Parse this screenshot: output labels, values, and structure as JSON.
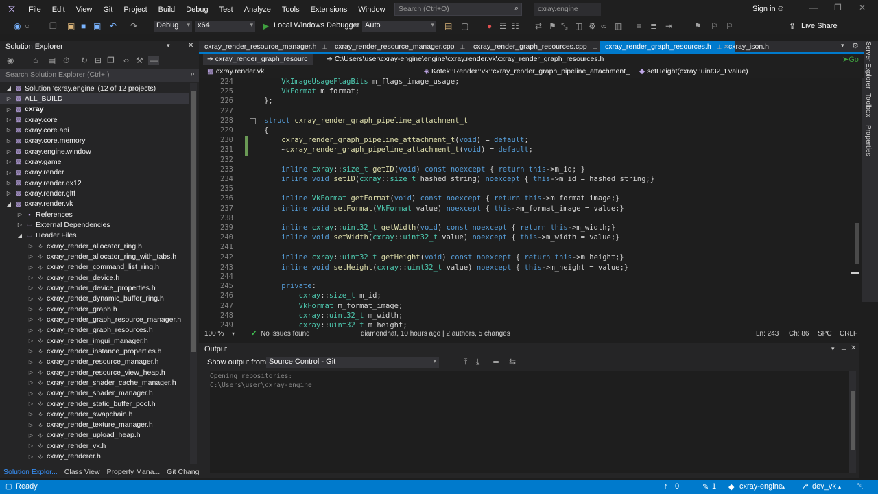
{
  "menubar": {
    "items": [
      "File",
      "Edit",
      "View",
      "Git",
      "Project",
      "Build",
      "Debug",
      "Test",
      "Analyze",
      "Tools",
      "Extensions",
      "Window",
      "Help"
    ],
    "search_placeholder": "Search (Ctrl+Q)",
    "title": "cxray.engine",
    "sign_in": "Sign in"
  },
  "toolbar": {
    "config": "Debug",
    "platform": "x64",
    "debugger": "Local Windows Debugger",
    "mode": "Auto",
    "live_share": "Live Share"
  },
  "solution_explorer": {
    "title": "Solution Explorer",
    "search_placeholder": "Search Solution Explorer (Ctrl+;)",
    "items": [
      {
        "label": "Solution 'cxray.engine' (12 of 12 projects)",
        "depth": 0,
        "twisty": "open",
        "kind": "solution"
      },
      {
        "label": "ALL_BUILD",
        "depth": 0,
        "twisty": "closed",
        "kind": "project",
        "selected": true
      },
      {
        "label": "cxray",
        "depth": 0,
        "twisty": "closed",
        "kind": "project",
        "bold": true
      },
      {
        "label": "cxray.core",
        "depth": 0,
        "twisty": "closed",
        "kind": "project"
      },
      {
        "label": "cxray.core.api",
        "depth": 0,
        "twisty": "closed",
        "kind": "project"
      },
      {
        "label": "cxray.core.memory",
        "depth": 0,
        "twisty": "closed",
        "kind": "project"
      },
      {
        "label": "cxray.engine.window",
        "depth": 0,
        "twisty": "closed",
        "kind": "project"
      },
      {
        "label": "cxray.game",
        "depth": 0,
        "twisty": "closed",
        "kind": "project"
      },
      {
        "label": "cxray.render",
        "depth": 0,
        "twisty": "closed",
        "kind": "project"
      },
      {
        "label": "cxray.render.dx12",
        "depth": 0,
        "twisty": "closed",
        "kind": "project"
      },
      {
        "label": "cxray.render.gltf",
        "depth": 0,
        "twisty": "closed",
        "kind": "project"
      },
      {
        "label": "cxray.render.vk",
        "depth": 0,
        "twisty": "open",
        "kind": "project"
      },
      {
        "label": "References",
        "depth": 1,
        "twisty": "closed",
        "kind": "ref"
      },
      {
        "label": "External Dependencies",
        "depth": 1,
        "twisty": "closed",
        "kind": "folder"
      },
      {
        "label": "Header Files",
        "depth": 1,
        "twisty": "open",
        "kind": "folder"
      },
      {
        "label": "cxray_render_allocator_ring.h",
        "depth": 2,
        "twisty": "closed",
        "kind": "file"
      },
      {
        "label": "cxray_render_allocator_ring_with_tabs.h",
        "depth": 2,
        "twisty": "closed",
        "kind": "file"
      },
      {
        "label": "cxray_render_command_list_ring.h",
        "depth": 2,
        "twisty": "closed",
        "kind": "file"
      },
      {
        "label": "cxray_render_device.h",
        "depth": 2,
        "twisty": "closed",
        "kind": "file"
      },
      {
        "label": "cxray_render_device_properties.h",
        "depth": 2,
        "twisty": "closed",
        "kind": "file"
      },
      {
        "label": "cxray_render_dynamic_buffer_ring.h",
        "depth": 2,
        "twisty": "closed",
        "kind": "file"
      },
      {
        "label": "cxray_render_graph.h",
        "depth": 2,
        "twisty": "closed",
        "kind": "file"
      },
      {
        "label": "cxray_render_graph_resource_manager.h",
        "depth": 2,
        "twisty": "closed",
        "kind": "file"
      },
      {
        "label": "cxray_render_graph_resources.h",
        "depth": 2,
        "twisty": "closed",
        "kind": "file"
      },
      {
        "label": "cxray_render_imgui_manager.h",
        "depth": 2,
        "twisty": "closed",
        "kind": "file"
      },
      {
        "label": "cxray_render_instance_properties.h",
        "depth": 2,
        "twisty": "closed",
        "kind": "file"
      },
      {
        "label": "cxray_render_resource_manager.h",
        "depth": 2,
        "twisty": "closed",
        "kind": "file"
      },
      {
        "label": "cxray_render_resource_view_heap.h",
        "depth": 2,
        "twisty": "closed",
        "kind": "file"
      },
      {
        "label": "cxray_render_shader_cache_manager.h",
        "depth": 2,
        "twisty": "closed",
        "kind": "file"
      },
      {
        "label": "cxray_render_shader_manager.h",
        "depth": 2,
        "twisty": "closed",
        "kind": "file"
      },
      {
        "label": "cxray_render_static_buffer_pool.h",
        "depth": 2,
        "twisty": "closed",
        "kind": "file"
      },
      {
        "label": "cxray_render_swapchain.h",
        "depth": 2,
        "twisty": "closed",
        "kind": "file"
      },
      {
        "label": "cxray_render_texture_manager.h",
        "depth": 2,
        "twisty": "closed",
        "kind": "file"
      },
      {
        "label": "cxray_render_upload_heap.h",
        "depth": 2,
        "twisty": "closed",
        "kind": "file"
      },
      {
        "label": "cxray_render_vk.h",
        "depth": 2,
        "twisty": "closed",
        "kind": "file"
      },
      {
        "label": "cxray_renderer.h",
        "depth": 2,
        "twisty": "closed",
        "kind": "file"
      }
    ],
    "bottom_tabs": [
      "Solution Explor...",
      "Class View",
      "Property Mana...",
      "Git Changes"
    ]
  },
  "doc_tabs": [
    {
      "label": "cxray_render_resource_manager.h",
      "active": false
    },
    {
      "label": "cxray_render_resource_manager.cpp",
      "active": false
    },
    {
      "label": "cxray_render_graph_resources.cpp",
      "active": false
    },
    {
      "label": "cxray_render_graph_resources.h",
      "active": true
    },
    {
      "label": "cxray_json.h",
      "active": false
    }
  ],
  "navbar": {
    "file_dd": "cxray_render_graph_resourc",
    "path": "C:\\Users\\user\\cxray-engine\\engine\\cxray.render.vk\\cxray_render_graph_resources.h",
    "project_dd": "cxray.render.vk",
    "scope_dd": "Kotek::Render::vk::cxray_render_graph_pipeline_attachment_t::cxray_render_gra",
    "member_dd": "setHeight(cxray::uint32_t value)"
  },
  "code": [
    {
      "n": "224",
      "t": "    VkImageUsageFlagBits m_flags_image_usage;"
    },
    {
      "n": "225",
      "t": "    VkFormat m_format;"
    },
    {
      "n": "226",
      "t": "};"
    },
    {
      "n": "227",
      "t": ""
    },
    {
      "n": "228",
      "t": "struct cxray_render_graph_pipeline_attachment_t"
    },
    {
      "n": "229",
      "t": "{"
    },
    {
      "n": "230",
      "t": "    cxray_render_graph_pipeline_attachment_t(void) = default;"
    },
    {
      "n": "231",
      "t": "    ~cxray_render_graph_pipeline_attachment_t(void) = default;"
    },
    {
      "n": "232",
      "t": ""
    },
    {
      "n": "233",
      "t": "    inline cxray::size_t getID(void) const noexcept { return this->m_id; }"
    },
    {
      "n": "234",
      "t": "    inline void setID(cxray::size_t hashed_string) noexcept { this->m_id = hashed_string;}"
    },
    {
      "n": "235",
      "t": ""
    },
    {
      "n": "236",
      "t": "    inline VkFormat getFormat(void) const noexcept { return this->m_format_image;}"
    },
    {
      "n": "237",
      "t": "    inline void setFormat(VkFormat value) noexcept { this->m_format_image = value;}"
    },
    {
      "n": "238",
      "t": ""
    },
    {
      "n": "239",
      "t": "    inline cxray::uint32_t getWidth(void) const noexcept { return this->m_width;}"
    },
    {
      "n": "240",
      "t": "    inline void setWidth(cxray::uint32_t value) noexcept { this->m_width = value;}"
    },
    {
      "n": "241",
      "t": ""
    },
    {
      "n": "242",
      "t": "    inline cxray::uint32_t getHeight(void) const noexcept { return this->m_height;}"
    },
    {
      "n": "243",
      "t": "    inline void setHeight(cxray::uint32_t value) noexcept { this->m_height = value;}"
    },
    {
      "n": "244",
      "t": ""
    },
    {
      "n": "245",
      "t": "    private:"
    },
    {
      "n": "246",
      "t": "        cxray::size_t m_id;"
    },
    {
      "n": "247",
      "t": "        VkFormat m_format_image;"
    },
    {
      "n": "248",
      "t": "        cxray::uint32_t m_width;"
    },
    {
      "n": "249",
      "t": "        cxray::uint32_t m_height;"
    }
  ],
  "editor_status": {
    "zoom": "100 %",
    "issues": "No issues found",
    "blame": "diamondhat, 10 hours ago | 2 authors, 5 changes",
    "line": "Ln: 243",
    "col": "Ch: 86",
    "spc": "SPC",
    "eol": "CRLF"
  },
  "output": {
    "title": "Output",
    "from_label": "Show output from:",
    "source": "Source Control - Git",
    "lines": [
      "Opening repositories:",
      "C:\\Users\\user\\cxray-engine"
    ]
  },
  "statusbar": {
    "ready": "Ready",
    "up_count": "0",
    "pencil_count": "1",
    "repo": "cxray-engine",
    "branch": "dev_vk"
  },
  "right_rail": [
    "Server Explorer",
    "Toolbox",
    "Properties"
  ],
  "colors": {
    "accent": "#007acc",
    "keyword": "#569cd6",
    "type": "#4ec9b0",
    "function": "#dcdcaa"
  }
}
